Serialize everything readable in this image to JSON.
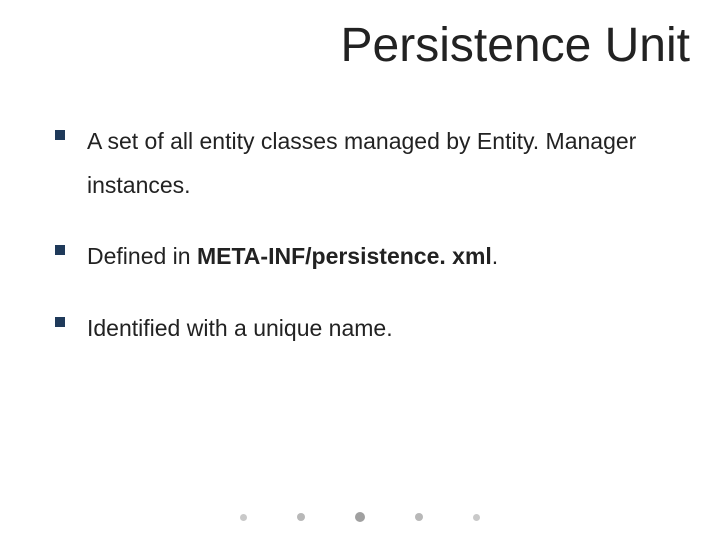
{
  "title": "Persistence Unit",
  "bullets": [
    {
      "pre": "A set of all entity classes managed by Entity. Manager instances.",
      "bold": "",
      "post": ""
    },
    {
      "pre": "Defined in ",
      "bold": "META-INF/persistence. xml",
      "post": "."
    },
    {
      "pre": "Identified with a unique name.",
      "bold": "",
      "post": ""
    }
  ]
}
